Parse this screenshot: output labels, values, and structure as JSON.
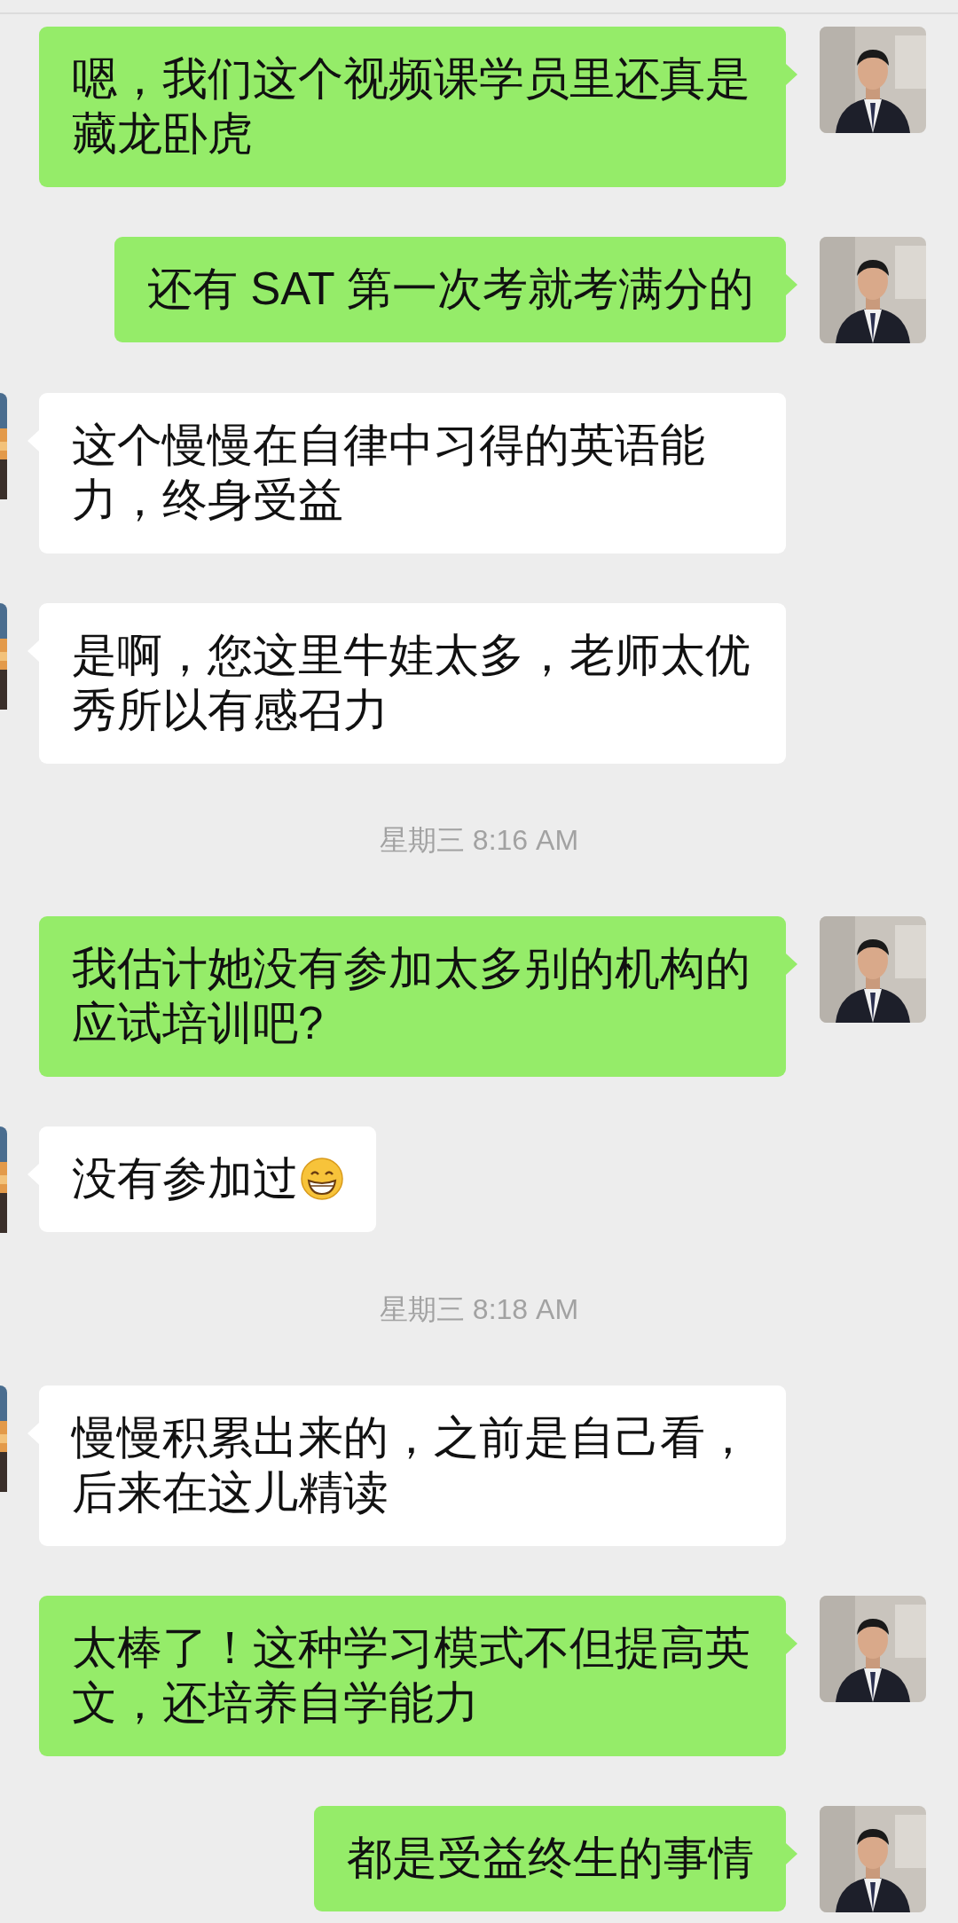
{
  "messages": [
    {
      "kind": "sent",
      "text": "嗯，我们这个视频课学员里还真是藏龙卧虎"
    },
    {
      "kind": "sent",
      "text": "还有 SAT 第一次考就考满分的"
    },
    {
      "kind": "received",
      "text": "这个慢慢在自律中习得的英语能力，终身受益"
    },
    {
      "kind": "received",
      "text": "是啊，您这里牛娃太多，老师太优秀所以有感召力"
    },
    {
      "kind": "timestamp",
      "text": "星期三 8:16 AM"
    },
    {
      "kind": "sent",
      "text": "我估计她没有参加太多别的机构的应试培训吧?"
    },
    {
      "kind": "received",
      "text": "没有参加过",
      "emoji": true
    },
    {
      "kind": "timestamp",
      "text": "星期三 8:18 AM"
    },
    {
      "kind": "received",
      "text": "慢慢积累出来的，之前是自己看，后来在这儿精读"
    },
    {
      "kind": "sent",
      "text": "太棒了！这种学习模式不但提高英文，还培养自学能力"
    },
    {
      "kind": "sent",
      "text": "都是受益终生的事情"
    }
  ]
}
